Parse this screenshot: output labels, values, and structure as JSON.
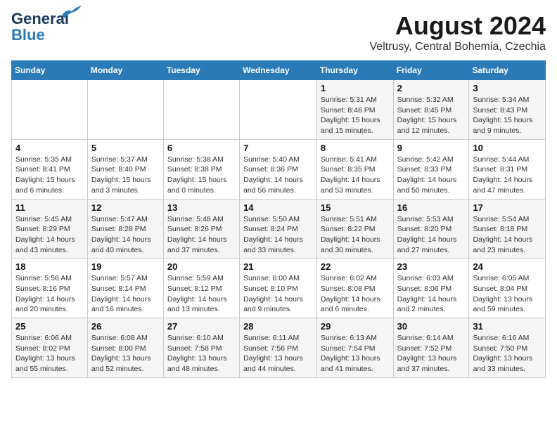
{
  "header": {
    "logo_line1": "General",
    "logo_line2": "Blue",
    "title": "August 2024",
    "subtitle": "Veltrusy, Central Bohemia, Czechia"
  },
  "days_of_week": [
    "Sunday",
    "Monday",
    "Tuesday",
    "Wednesday",
    "Thursday",
    "Friday",
    "Saturday"
  ],
  "weeks": [
    [
      {
        "day": "",
        "info": ""
      },
      {
        "day": "",
        "info": ""
      },
      {
        "day": "",
        "info": ""
      },
      {
        "day": "",
        "info": ""
      },
      {
        "day": "1",
        "info": "Sunrise: 5:31 AM\nSunset: 8:46 PM\nDaylight: 15 hours\nand 15 minutes."
      },
      {
        "day": "2",
        "info": "Sunrise: 5:32 AM\nSunset: 8:45 PM\nDaylight: 15 hours\nand 12 minutes."
      },
      {
        "day": "3",
        "info": "Sunrise: 5:34 AM\nSunset: 8:43 PM\nDaylight: 15 hours\nand 9 minutes."
      }
    ],
    [
      {
        "day": "4",
        "info": "Sunrise: 5:35 AM\nSunset: 8:41 PM\nDaylight: 15 hours\nand 6 minutes."
      },
      {
        "day": "5",
        "info": "Sunrise: 5:37 AM\nSunset: 8:40 PM\nDaylight: 15 hours\nand 3 minutes."
      },
      {
        "day": "6",
        "info": "Sunrise: 5:38 AM\nSunset: 8:38 PM\nDaylight: 15 hours\nand 0 minutes."
      },
      {
        "day": "7",
        "info": "Sunrise: 5:40 AM\nSunset: 8:36 PM\nDaylight: 14 hours\nand 56 minutes."
      },
      {
        "day": "8",
        "info": "Sunrise: 5:41 AM\nSunset: 8:35 PM\nDaylight: 14 hours\nand 53 minutes."
      },
      {
        "day": "9",
        "info": "Sunrise: 5:42 AM\nSunset: 8:33 PM\nDaylight: 14 hours\nand 50 minutes."
      },
      {
        "day": "10",
        "info": "Sunrise: 5:44 AM\nSunset: 8:31 PM\nDaylight: 14 hours\nand 47 minutes."
      }
    ],
    [
      {
        "day": "11",
        "info": "Sunrise: 5:45 AM\nSunset: 8:29 PM\nDaylight: 14 hours\nand 43 minutes."
      },
      {
        "day": "12",
        "info": "Sunrise: 5:47 AM\nSunset: 8:28 PM\nDaylight: 14 hours\nand 40 minutes."
      },
      {
        "day": "13",
        "info": "Sunrise: 5:48 AM\nSunset: 8:26 PM\nDaylight: 14 hours\nand 37 minutes."
      },
      {
        "day": "14",
        "info": "Sunrise: 5:50 AM\nSunset: 8:24 PM\nDaylight: 14 hours\nand 33 minutes."
      },
      {
        "day": "15",
        "info": "Sunrise: 5:51 AM\nSunset: 8:22 PM\nDaylight: 14 hours\nand 30 minutes."
      },
      {
        "day": "16",
        "info": "Sunrise: 5:53 AM\nSunset: 8:20 PM\nDaylight: 14 hours\nand 27 minutes."
      },
      {
        "day": "17",
        "info": "Sunrise: 5:54 AM\nSunset: 8:18 PM\nDaylight: 14 hours\nand 23 minutes."
      }
    ],
    [
      {
        "day": "18",
        "info": "Sunrise: 5:56 AM\nSunset: 8:16 PM\nDaylight: 14 hours\nand 20 minutes."
      },
      {
        "day": "19",
        "info": "Sunrise: 5:57 AM\nSunset: 8:14 PM\nDaylight: 14 hours\nand 16 minutes."
      },
      {
        "day": "20",
        "info": "Sunrise: 5:59 AM\nSunset: 8:12 PM\nDaylight: 14 hours\nand 13 minutes."
      },
      {
        "day": "21",
        "info": "Sunrise: 6:00 AM\nSunset: 8:10 PM\nDaylight: 14 hours\nand 9 minutes."
      },
      {
        "day": "22",
        "info": "Sunrise: 6:02 AM\nSunset: 8:08 PM\nDaylight: 14 hours\nand 6 minutes."
      },
      {
        "day": "23",
        "info": "Sunrise: 6:03 AM\nSunset: 8:06 PM\nDaylight: 14 hours\nand 2 minutes."
      },
      {
        "day": "24",
        "info": "Sunrise: 6:05 AM\nSunset: 8:04 PM\nDaylight: 13 hours\nand 59 minutes."
      }
    ],
    [
      {
        "day": "25",
        "info": "Sunrise: 6:06 AM\nSunset: 8:02 PM\nDaylight: 13 hours\nand 55 minutes."
      },
      {
        "day": "26",
        "info": "Sunrise: 6:08 AM\nSunset: 8:00 PM\nDaylight: 13 hours\nand 52 minutes."
      },
      {
        "day": "27",
        "info": "Sunrise: 6:10 AM\nSunset: 7:58 PM\nDaylight: 13 hours\nand 48 minutes."
      },
      {
        "day": "28",
        "info": "Sunrise: 6:11 AM\nSunset: 7:56 PM\nDaylight: 13 hours\nand 44 minutes."
      },
      {
        "day": "29",
        "info": "Sunrise: 6:13 AM\nSunset: 7:54 PM\nDaylight: 13 hours\nand 41 minutes."
      },
      {
        "day": "30",
        "info": "Sunrise: 6:14 AM\nSunset: 7:52 PM\nDaylight: 13 hours\nand 37 minutes."
      },
      {
        "day": "31",
        "info": "Sunrise: 6:16 AM\nSunset: 7:50 PM\nDaylight: 13 hours\nand 33 minutes."
      }
    ]
  ]
}
